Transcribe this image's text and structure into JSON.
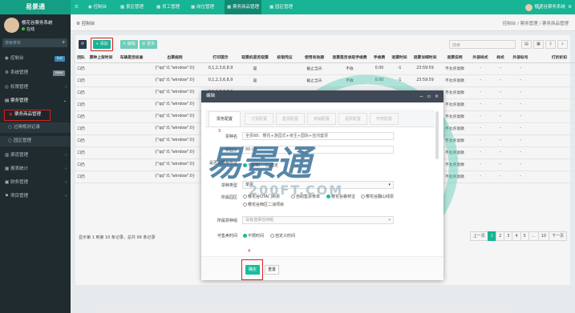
{
  "app": {
    "brand": "易景通"
  },
  "topnav": {
    "items": [
      "控制台",
      "景区管理",
      "员工管理",
      "岗位管理",
      "票务商品管理",
      "园区管理"
    ]
  },
  "topuser": {
    "name": "樱花谷票务系统"
  },
  "sidebar": {
    "user_name": "樱花谷票务系统",
    "status": "在线",
    "search_placeholder": "搜索菜单",
    "items": [
      {
        "label": "控制台",
        "badge": "hot"
      },
      {
        "label": "系统管理",
        "badge": "new"
      },
      {
        "label": "权限管理"
      },
      {
        "label": "票务管理"
      },
      {
        "label": "票务商品管理"
      },
      {
        "label": "过闸规则记录"
      },
      {
        "label": "园区管理"
      },
      {
        "label": "渠道管理"
      },
      {
        "label": "报表统计"
      },
      {
        "label": "财务管理"
      },
      {
        "label": "项目管理"
      }
    ],
    "colors": {
      "hot": "#f39c12",
      "new": "#3c8dbc"
    }
  },
  "crumb": {
    "left": "控制台",
    "right": "控制台 / 票务管理 / 票务商品管理"
  },
  "toolbar": {
    "refresh": "⟳",
    "add": "+ 添加",
    "edit": "✎ 编辑",
    "more": "⚙ 更多",
    "search_placeholder": "搜索"
  },
  "table": {
    "headers": [
      "团队",
      "票种上架时间",
      "车辆是否核查",
      "出票规则",
      "打印提示",
      "取票机是否取票",
      "核销凭证",
      "使用有效期",
      "退票是否收取手续费",
      "手续费",
      "退票时间",
      "退票详细时间",
      "退票说明",
      "外部样式",
      "样式",
      "外部标号",
      "打折折扣"
    ],
    "rows": [
      [
        "口仍",
        "",
        "",
        "{\"qq\":0,\"window\":0}",
        "0,1,2,3,6,8,9",
        "是",
        "",
        "截止当天",
        "不收",
        "0.00",
        "-1",
        "23:59:59",
        "不允许退款",
        "-",
        "-",
        "-",
        ""
      ],
      [
        "口仍",
        "",
        "",
        "{\"qq\":0,\"window\":0}",
        "0,1,2,3,6,8,9",
        "是",
        "",
        "截止当天",
        "不收",
        "0.00",
        "-1",
        "23:59:59",
        "不允许退款",
        "-",
        "-",
        "-",
        ""
      ],
      [
        "口仍",
        "",
        "",
        "{\"qq\":0,\"window\":0}",
        "0,1,2,3,6,8,9",
        "",
        "",
        "",
        "",
        "",
        "",
        "",
        "不允许退款",
        "-",
        "-",
        "-",
        ""
      ],
      [
        "口仍",
        "",
        "",
        "{\"qq\":0,\"window\":0}",
        "",
        "",
        "",
        "",
        "",
        "",
        "",
        "",
        "不允许退款",
        "-",
        "-",
        "-",
        ""
      ],
      [
        "口仍",
        "",
        "",
        "{\"qq\":0,\"window\":0}",
        "",
        "",
        "",
        "",
        "",
        "",
        "",
        "",
        "不允许退款",
        "-",
        "-",
        "-",
        ""
      ],
      [
        "口仍",
        "",
        "",
        "{\"qq\":0,\"window\":0}",
        "",
        "",
        "",
        "",
        "",
        "",
        "",
        "",
        "不允许退款",
        "-",
        "-",
        "-",
        ""
      ],
      [
        "口仍",
        "",
        "",
        "{\"qq\":0,\"window\":0}",
        "",
        "",
        "",
        "",
        "",
        "",
        "",
        "",
        "不允许退款",
        "-",
        "-",
        "-",
        ""
      ],
      [
        "口仍",
        "",
        "",
        "{\"qq\":0,\"window\":0}",
        "",
        "",
        "",
        "",
        "",
        "",
        "",
        "",
        "不允许退款",
        "-",
        "-",
        "-",
        ""
      ],
      [
        "口仍",
        "",
        "",
        "{\"qq\":0,\"window\":0}",
        "",
        "",
        "",
        "",
        "",
        "",
        "",
        "",
        "不允许退款",
        "-",
        "-",
        "-",
        ""
      ],
      [
        "口仍",
        "",
        "",
        "{\"qq\":0,\"window\":0}",
        "",
        "",
        "",
        "",
        "",
        "",
        "",
        "",
        "不允许退款",
        "-",
        "-",
        "-",
        ""
      ]
    ]
  },
  "footer_text": "显示第 1 到第 10 条记录，总共 99 条记录",
  "pager": [
    "上一页",
    "1",
    "2",
    "3",
    "4",
    "5",
    "...",
    "10",
    "下一页"
  ],
  "modal": {
    "title": "编辑",
    "tabs": [
      "票务配置",
      "订票配置",
      "售票配置",
      "核销配置",
      "退票配置",
      "开放配置"
    ],
    "fields": {
      "name_label": "票种名",
      "name_value": "全票88：樱花+游园式+亲生+国际+亚鸿套票",
      "price_label": "票面价",
      "price_value": "88.00",
      "need_verify_label": "是否需要身份证",
      "need_verify_opts": [
        "不限制",
        "指定"
      ],
      "ticket_type_label": "票种类型",
      "ticket_type_value": "单票",
      "park_label": "所属园区",
      "park_opts": [
        "樱花谷OTA门购票",
        "自助售票亲单",
        "樱花谷森林宝",
        "樱花谷翻山线票",
        "樱花谷西区二消项目"
      ],
      "group_label": "所属票种组",
      "group_placeholder": "没有选择任何组",
      "time_label": "可售卖时间",
      "time_opts": [
        "不限时间",
        "自定义时间"
      ]
    },
    "ok": "确定",
    "reset": "重置"
  },
  "annotations": [
    "3",
    "4"
  ],
  "watermark": {
    "text": "易景通",
    "url": "200FT.COM"
  }
}
